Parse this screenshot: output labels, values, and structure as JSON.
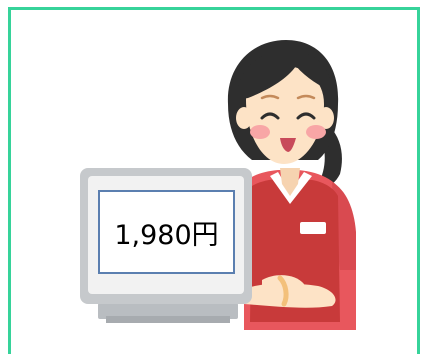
{
  "price_sign": {
    "price_text": "1,980円"
  },
  "colors": {
    "frame_border": "#36d39a",
    "monitor_bezel": "#c6c9cc",
    "monitor_screen": "#f2f2f2",
    "price_box_border": "#5b7fb0",
    "apron": "#c83a3a",
    "shirt": "#e8575d",
    "hair": "#2e2e2e",
    "skin": "#fde3c6",
    "cheek": "#f8a6a6",
    "bangle": "#f3c07a"
  }
}
